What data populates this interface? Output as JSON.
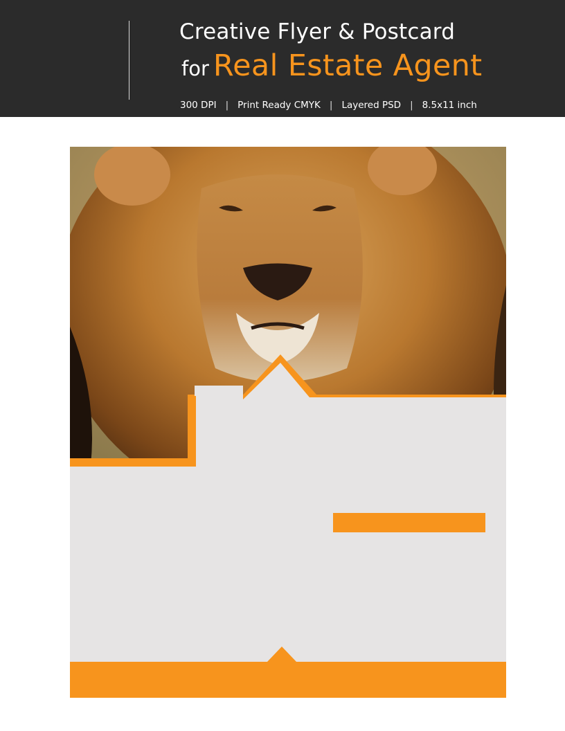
{
  "banner": {
    "title_line1": "Creative Flyer & Postcard",
    "title_for": "for",
    "title_accent": "Real Estate Agent",
    "specs": [
      "300 DPI",
      "Print Ready CMYK",
      "Layered PSD",
      "8.5x11 inch"
    ],
    "separator": "|"
  },
  "colors": {
    "banner_bg": "#2b2b2b",
    "accent": "#f7941d",
    "panel_gray": "#e6e4e4"
  },
  "flyer": {
    "photo_subject": "lion"
  }
}
